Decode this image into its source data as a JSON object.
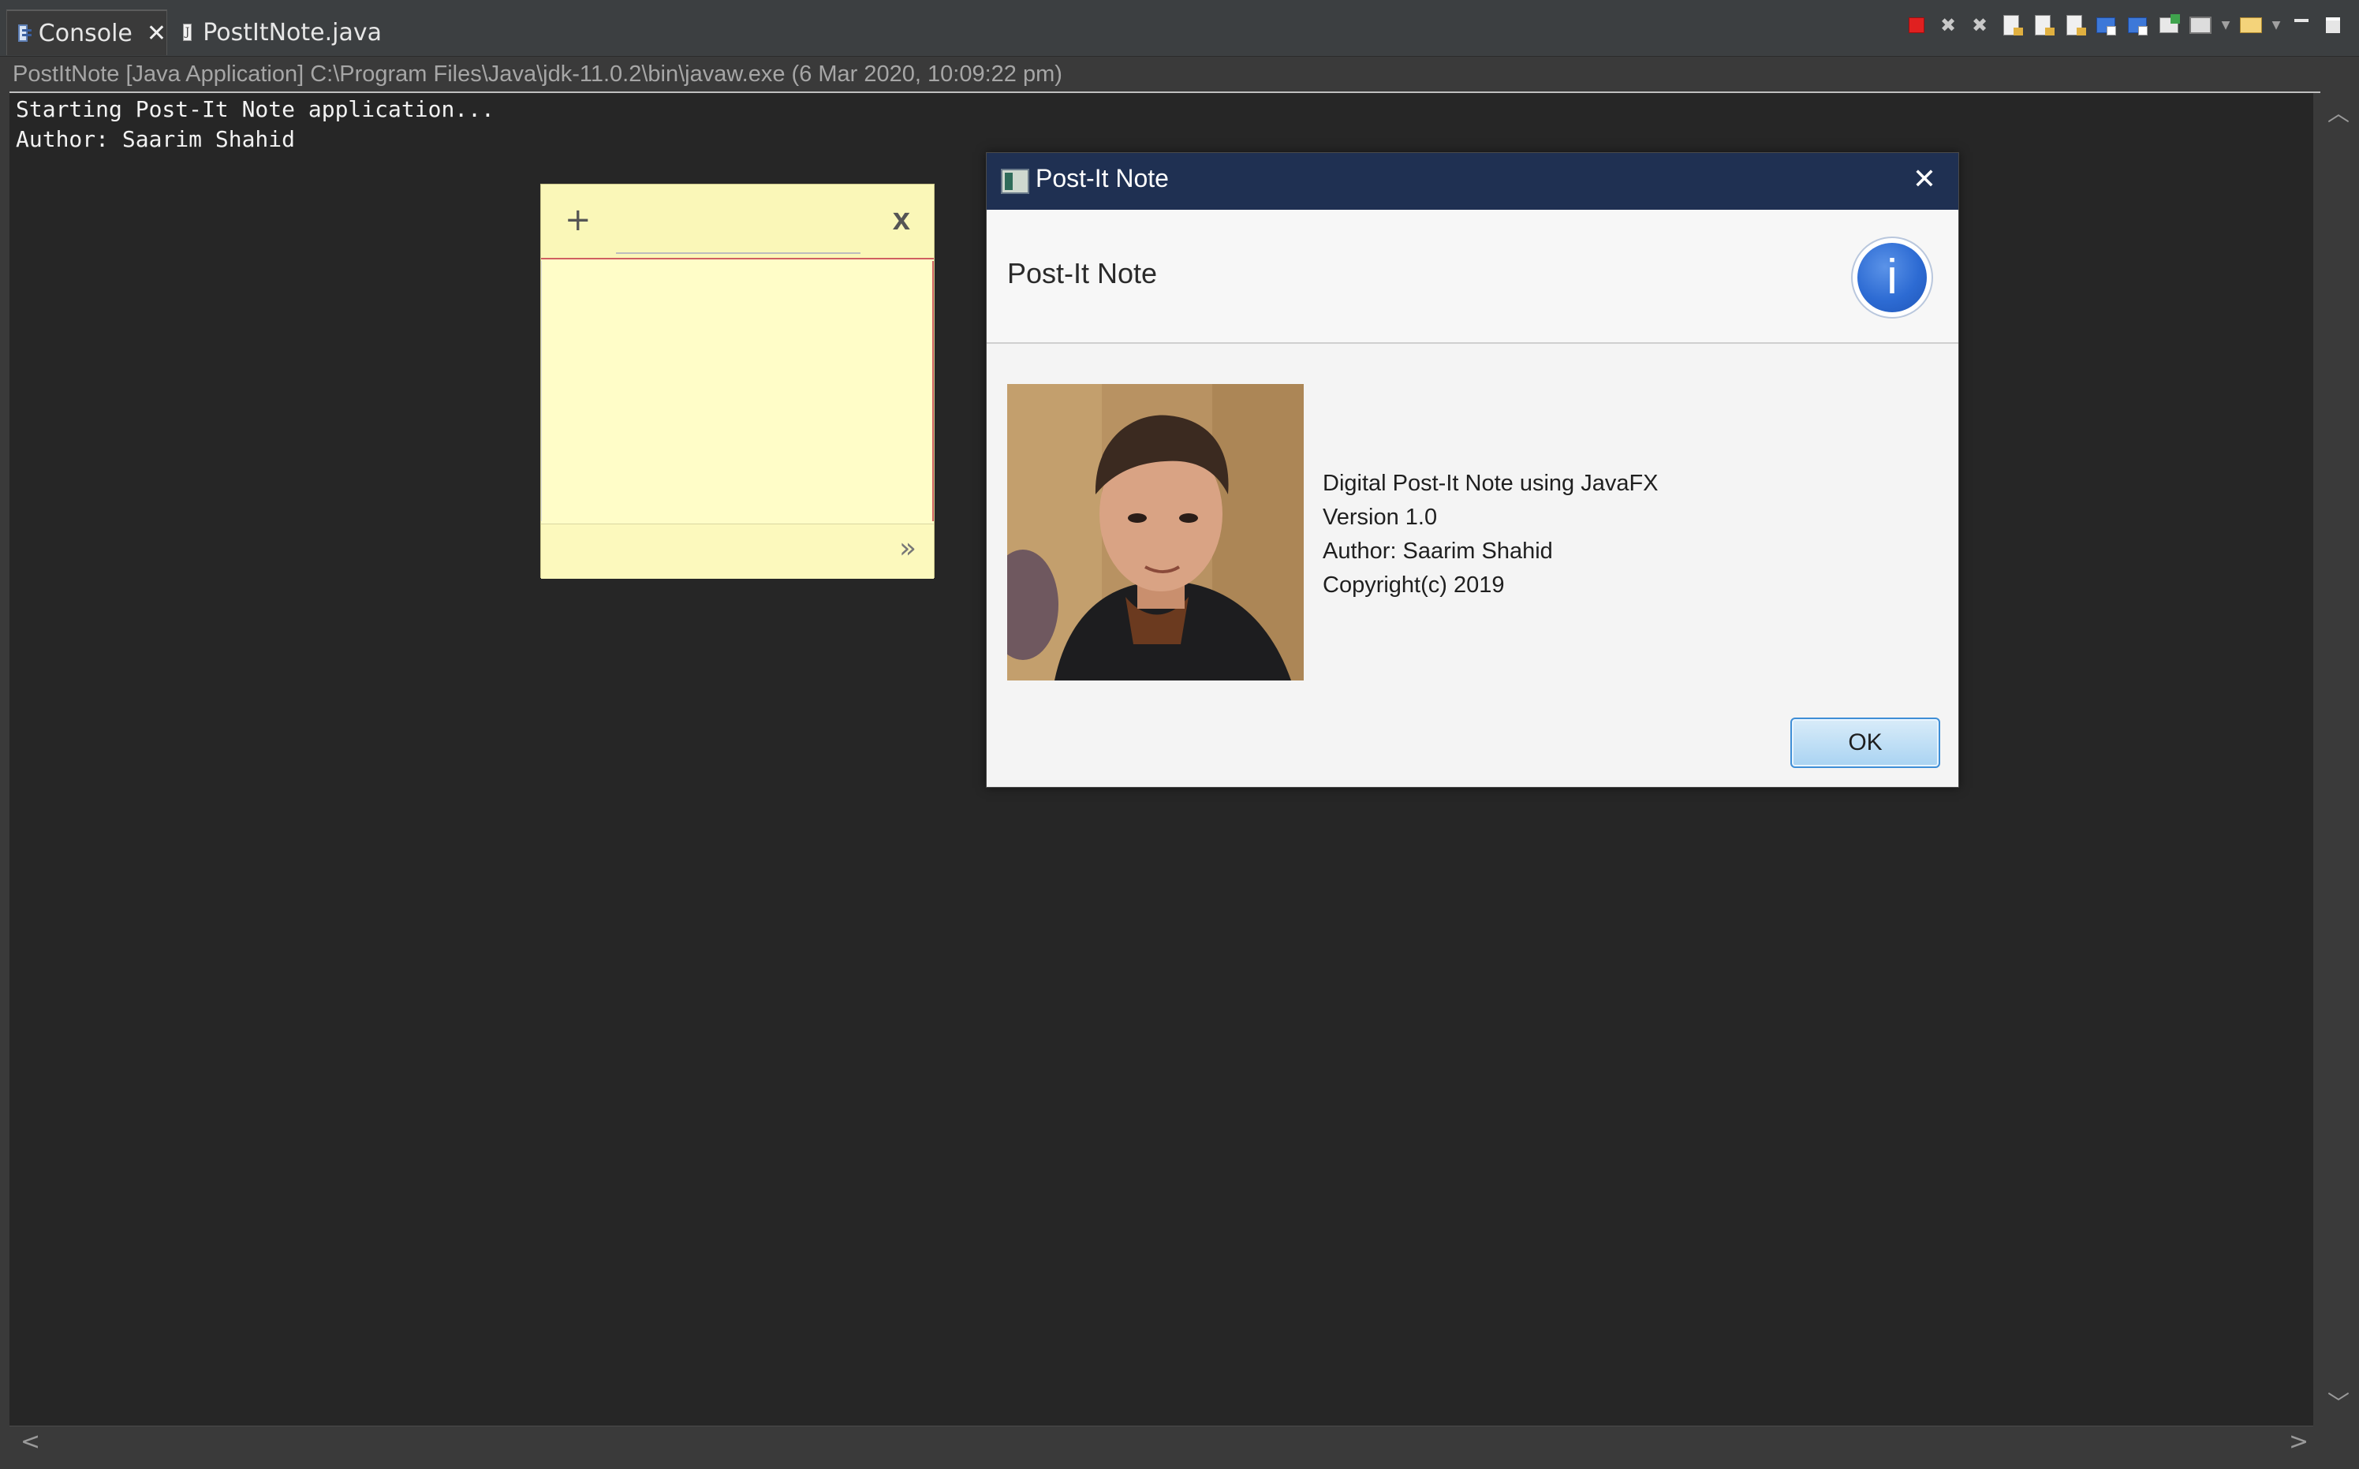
{
  "tabs": [
    {
      "label": "Console",
      "icon": "console-icon",
      "active": true,
      "close": "✕"
    },
    {
      "label": "PostItNote.java",
      "icon": "java-file-icon",
      "active": false
    }
  ],
  "toolbar": {
    "icons": [
      "terminate-icon",
      "remove-launch-icon",
      "remove-all-terminated-icon",
      "show-console-icon",
      "scroll-lock-icon",
      "word-wrap-icon",
      "pin-console-icon",
      "display-selected-console-icon",
      "open-console-icon",
      "new-console-icon",
      "minimize-icon",
      "maximize-icon"
    ]
  },
  "launch_line": "PostItNote [Java Application] C:\\Program Files\\Java\\jdk-11.0.2\\bin\\javaw.exe (6 Mar 2020, 10:09:22 pm)",
  "console": {
    "lines": [
      "Starting Post-It Note application...",
      "Author: Saarim Shahid"
    ]
  },
  "sticky_note": {
    "add_label": "+",
    "close_label": "x",
    "more_label": "»",
    "colors": {
      "body": "#fffdc8",
      "header": "#faf7b8",
      "accent": "#d06060"
    }
  },
  "dialog": {
    "title": "Post-It Note",
    "close_label": "✕",
    "header_text": "Post-It Note",
    "info_icon_label": "i",
    "about_lines": [
      "Digital Post-It Note using JavaFX",
      "Version 1.0",
      "Author: Saarim Shahid",
      "Copyright(c) 2019"
    ],
    "ok_label": "OK",
    "colors": {
      "titlebar": "#1f3052",
      "ok_border": "#3f8ed6"
    }
  },
  "scrollbars": {
    "up": "︿",
    "down": "﹀",
    "left": "<",
    "right": ">"
  }
}
